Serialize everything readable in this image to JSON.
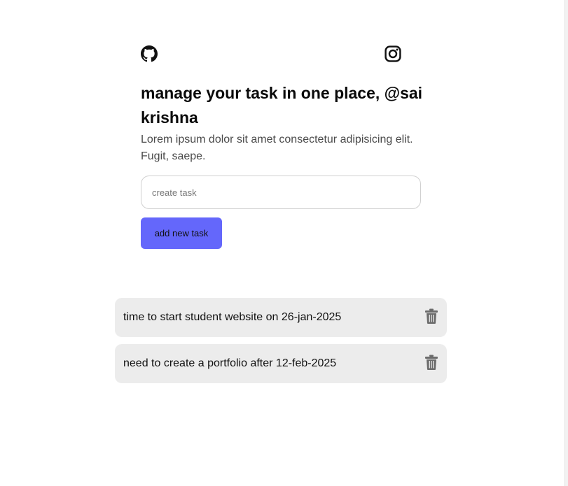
{
  "header": {
    "left_icon": "github-icon",
    "right_icon": "instagram-icon"
  },
  "hero": {
    "title": "manage your task in one place, @sai krishna",
    "description": "Lorem ipsum dolor sit amet consectetur adipisicing elit. Fugit, saepe."
  },
  "form": {
    "input_value": "",
    "input_placeholder": "create task",
    "button_label": "add new task",
    "button_color": "#6467fb"
  },
  "tasks": [
    {
      "text": "time to start student website on 26-jan-2025",
      "action_icon": "trash-icon"
    },
    {
      "text": "need to create a portfolio after 12-feb-2025",
      "action_icon": "trash-icon"
    }
  ]
}
